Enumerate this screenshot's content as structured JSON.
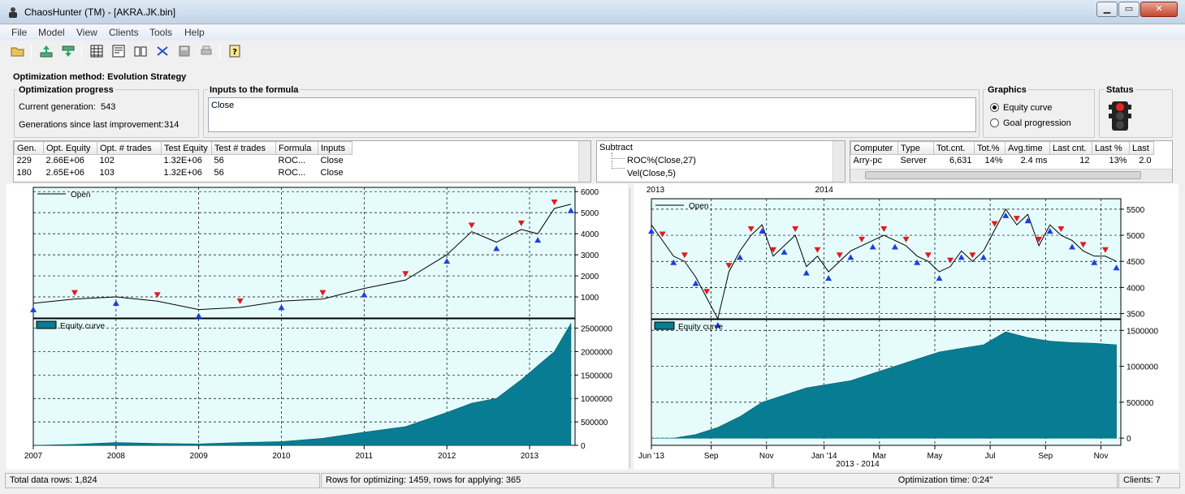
{
  "window": {
    "title": "ChaosHunter (TM) - [AKRA.JK.bin]"
  },
  "menu": [
    "File",
    "Model",
    "View",
    "Clients",
    "Tools",
    "Help"
  ],
  "toolbar": {
    "icons": [
      "open-folder-icon",
      "upload-icon",
      "download-icon",
      "table-icon",
      "grid-icon",
      "book-icon",
      "network-icon",
      "save-icon",
      "print-icon",
      "help-icon"
    ]
  },
  "method": {
    "label": "Optimization method: Evolution Strategy"
  },
  "progress": {
    "title": "Optimization progress",
    "current_generation_label": "Current generation:",
    "current_generation": "543",
    "since_label": "Generations since last improvement:",
    "since": "314"
  },
  "inputs": {
    "title": "Inputs to the formula",
    "value": "Close"
  },
  "graphics": {
    "title": "Graphics",
    "option1": "Equity curve",
    "option2": "Goal progression"
  },
  "status": {
    "title": "Status"
  },
  "gen_table": {
    "headers": [
      "Gen.",
      "Opt. Equity",
      "Opt. # trades",
      "Test Equity",
      "Test # trades",
      "Formula",
      "Inputs"
    ],
    "rows": [
      [
        "229",
        "2.66E+06",
        "102",
        "1.32E+06",
        "56",
        "ROC...",
        "Close"
      ],
      [
        "180",
        "2.65E+06",
        "103",
        "1.32E+06",
        "56",
        "ROC...",
        "Close"
      ]
    ]
  },
  "formula_tree": {
    "root": "Subtract",
    "child1": "ROC%(Close,27)",
    "child2": "Vel(Close,5)"
  },
  "clients_table": {
    "headers": [
      "Computer",
      "Type",
      "Tot.cnt.",
      "Tot.%",
      "Avg.time",
      "Last cnt.",
      "Last %",
      "Last"
    ],
    "rows": [
      [
        "Arry-pc",
        "Server",
        "6,631",
        "14%",
        "2.4 ms",
        "12",
        "13%",
        "2.0"
      ]
    ]
  },
  "left_chart": {
    "price_legend": "Open",
    "equity_legend": "Equity curve",
    "price_ticks": [
      "6000",
      "5000",
      "4000",
      "3000",
      "2000",
      "1000"
    ],
    "equity_ticks": [
      "2500000",
      "2000000",
      "1500000",
      "1000000",
      "500000",
      "0"
    ],
    "x_ticks": [
      "2007",
      "2008",
      "2009",
      "2010",
      "2011",
      "2012",
      "2013"
    ]
  },
  "right_chart": {
    "price_legend": "Open",
    "equity_legend": "Equity curve",
    "top_ticks": [
      "2013",
      "2014"
    ],
    "price_ticks": [
      "5500",
      "5000",
      "4500",
      "4000",
      "3500"
    ],
    "equity_ticks": [
      "1500000",
      "1000000",
      "500000",
      "0"
    ],
    "x_ticks": [
      "Jun '13",
      "Sep",
      "Nov",
      "Jan '14",
      "Mar",
      "May",
      "Jul",
      "Sep",
      "Nov"
    ],
    "x_title": "2013 - 2014"
  },
  "chart_data": [
    {
      "type": "line",
      "title": "",
      "series": [
        {
          "name": "Open",
          "x": [
            2007.0,
            2007.5,
            2008.0,
            2008.5,
            2009.0,
            2009.5,
            2010.0,
            2010.5,
            2011.0,
            2011.5,
            2012.0,
            2012.3,
            2012.6,
            2012.9,
            2013.1,
            2013.3,
            2013.5
          ],
          "values": [
            700,
            900,
            1000,
            800,
            400,
            500,
            800,
            900,
            1400,
            1800,
            3000,
            4100,
            3600,
            4200,
            4000,
            5200,
            5400
          ]
        },
        {
          "name": "Equity curve",
          "x": [
            2007.0,
            2007.5,
            2008.0,
            2008.5,
            2009.0,
            2009.5,
            2010.0,
            2010.5,
            2011.0,
            2011.5,
            2012.0,
            2012.3,
            2012.6,
            2012.9,
            2013.1,
            2013.3,
            2013.5
          ],
          "values": [
            0,
            20000,
            60000,
            40000,
            30000,
            60000,
            80000,
            150000,
            280000,
            400000,
            700000,
            900000,
            1000000,
            1400000,
            1700000,
            2000000,
            2600000
          ]
        }
      ],
      "ylim_price": [
        0,
        6200
      ],
      "ylim_equity": [
        0,
        2700000
      ]
    },
    {
      "type": "line",
      "title": "",
      "x_title": "2013 - 2014",
      "series": [
        {
          "name": "Open",
          "x": [
            0,
            0.5,
            1,
            1.5,
            2,
            2.5,
            3,
            3.5,
            4,
            4.5,
            5,
            5.5,
            6,
            6.5,
            7,
            7.5,
            8,
            8.5,
            9,
            9.5,
            10,
            10.5,
            11,
            11.5,
            12,
            12.5,
            13,
            13.5,
            14,
            14.5,
            15,
            15.5,
            16,
            16.5,
            17,
            17.5,
            18,
            18.5,
            19,
            19.5,
            20,
            20.5,
            21
          ],
          "values": [
            5200,
            4900,
            4600,
            4500,
            4200,
            3800,
            3400,
            4300,
            4700,
            5000,
            5200,
            4600,
            4800,
            5000,
            4400,
            4600,
            4300,
            4500,
            4700,
            4800,
            4900,
            5000,
            4900,
            4800,
            4600,
            4500,
            4300,
            4400,
            4700,
            4500,
            4700,
            5100,
            5500,
            5200,
            5400,
            4800,
            5200,
            5000,
            4900,
            4700,
            4600,
            4600,
            4500
          ],
          "ylim": [
            3400,
            5700
          ]
        },
        {
          "name": "Equity curve",
          "x": [
            0,
            1,
            2,
            3,
            4,
            5,
            6,
            7,
            8,
            9,
            10,
            11,
            12,
            13,
            14,
            15,
            16,
            17,
            18,
            19,
            20,
            21
          ],
          "values": [
            0,
            0,
            50000,
            150000,
            300000,
            500000,
            600000,
            700000,
            750000,
            800000,
            900000,
            1000000,
            1100000,
            1200000,
            1250000,
            1300000,
            1480000,
            1400000,
            1350000,
            1330000,
            1320000,
            1300000
          ],
          "ylim": [
            -100000,
            1650000
          ]
        }
      ]
    }
  ],
  "statusbar": {
    "total_rows": "Total data rows: 1,824",
    "rows_opt": "Rows for optimizing: 1459, rows for applying: 365",
    "opt_time": "Optimization time: 0:24\"",
    "clients": "Clients: 7"
  }
}
